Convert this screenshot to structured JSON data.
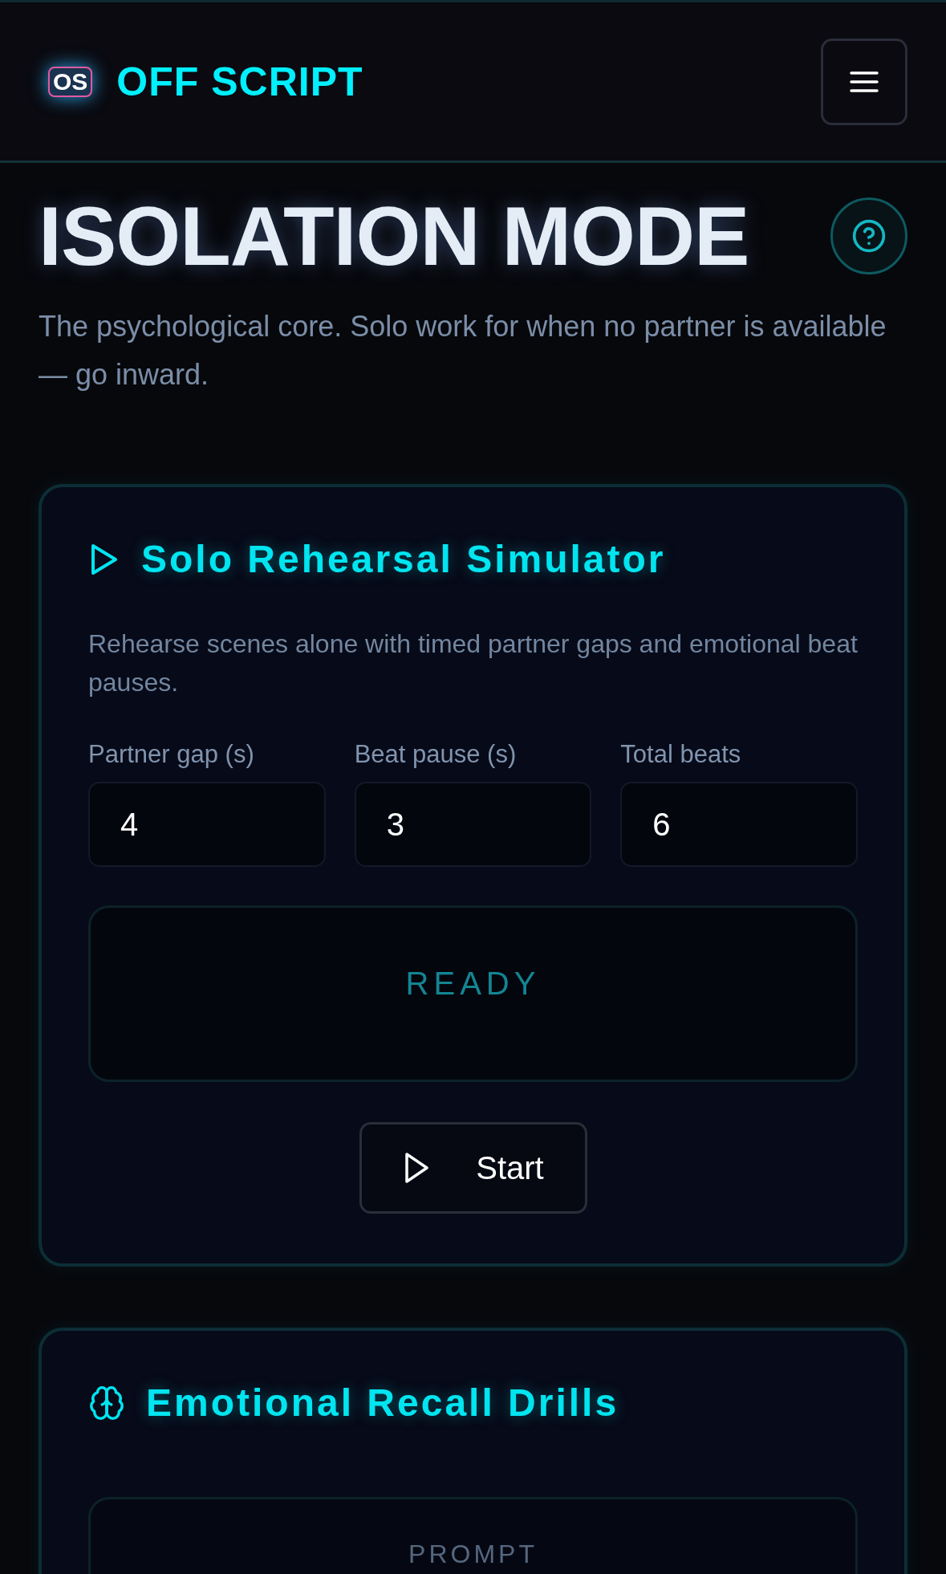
{
  "header": {
    "logo_text": "OS",
    "title": "OFF SCRIPT"
  },
  "page": {
    "title": "ISOLATION MODE",
    "description": "The psychological core. Solo work for when no partner is available — go inward."
  },
  "cards": [
    {
      "kind": "simulator",
      "title": "Solo Rehearsal Simulator",
      "description": "Rehearse scenes alone with timed partner gaps and emotional beat pauses.",
      "fields": [
        {
          "label": "Partner gap (s)",
          "value": "4"
        },
        {
          "label": "Beat pause (s)",
          "value": "3"
        },
        {
          "label": "Total beats",
          "value": "6"
        }
      ],
      "status": "READY",
      "button": "Start"
    },
    {
      "kind": "drills",
      "title": "Emotional Recall Drills",
      "panel_label": "PROMPT"
    }
  ]
}
